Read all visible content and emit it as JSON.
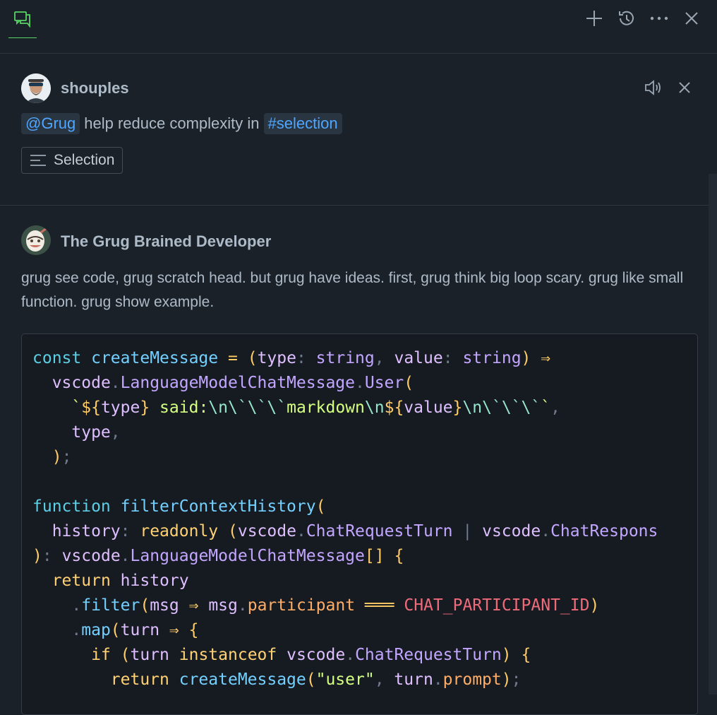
{
  "topbar": {
    "chat_tab_icon": "chat-icon",
    "actions": [
      {
        "name": "new-chat-button",
        "icon": "plus-icon"
      },
      {
        "name": "history-button",
        "icon": "history-icon"
      },
      {
        "name": "more-actions-button",
        "icon": "ellipsis-icon"
      },
      {
        "name": "close-panel-button",
        "icon": "close-icon"
      }
    ]
  },
  "request": {
    "username": "shouples",
    "agent_chip": "@Grug",
    "prompt_text": "help reduce complexity in",
    "variable_chip": "#selection",
    "attachment_label": "Selection",
    "actions": [
      "speaker-icon",
      "close-icon"
    ]
  },
  "response": {
    "author": "The Grug Brained Developer",
    "text": "grug see code, grug scratch head. but grug have ideas. first, grug think big loop scary. grug like small function. grug show example.",
    "code_lines": [
      "const createMessage = (type: string, value: string) ⇒",
      "  vscode.LanguageModelChatMessage.User(",
      "    `${type} said:\\n\\`\\`\\`markdown\\n${value}\\n\\`\\`\\``,",
      "    type,",
      "  );",
      "",
      "function filterContextHistory(",
      "  history: readonly (vscode.ChatRequestTurn | vscode.ChatRespons",
      "): vscode.LanguageModelChatMessage[] {",
      "  return history",
      "    .filter(msg ⇒ msg.participant ═══ CHAT_PARTICIPANT_ID)",
      "    .map(turn ⇒ {",
      "      if (turn instanceof vscode.ChatRequestTurn) {",
      "        return createMessage(\"user\", turn.prompt);"
    ]
  },
  "colors": {
    "background": "#1b2128",
    "accent_green": "#56d364",
    "chip_text": "#4fa6ff",
    "code_background": "#161b22"
  }
}
